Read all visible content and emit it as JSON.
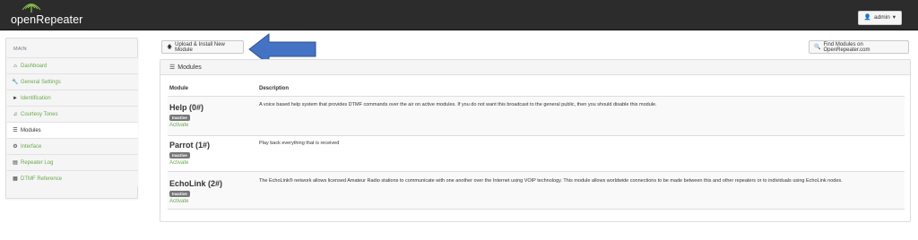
{
  "navbar": {
    "brand_text": "openRepeater",
    "user_label": "admin"
  },
  "sidebar": {
    "heading": "MAIN",
    "items": [
      {
        "label": "Dashboard",
        "icon": "home-icon",
        "active": false
      },
      {
        "label": "General Settings",
        "icon": "wrench-icon",
        "active": false
      },
      {
        "label": "Identification",
        "icon": "bullhorn-icon",
        "active": false
      },
      {
        "label": "Courtesy Tones",
        "icon": "music-icon",
        "active": false
      },
      {
        "label": "Modules",
        "icon": "list-icon",
        "active": true
      },
      {
        "label": "Interface",
        "icon": "cog-icon",
        "active": false
      },
      {
        "label": "Repeater Log",
        "icon": "log-icon",
        "active": false
      },
      {
        "label": "DTMF Reference",
        "icon": "keypad-icon",
        "active": false
      }
    ]
  },
  "toolbar": {
    "upload_label": "Upload & Install New Module",
    "find_label": "Find Modules on OpenRepeater.com"
  },
  "panel": {
    "title": "Modules",
    "columns": [
      "Module",
      "Description"
    ],
    "modules": [
      {
        "name": "Help (0#)",
        "status": "Inactive",
        "action": "Activate",
        "description": "A voice based help system that provides DTMF commands over the air on active modules. If you do not want this broadcast to the general public, then you should disable this module."
      },
      {
        "name": "Parrot (1#)",
        "status": "Inactive",
        "action": "Activate",
        "description": "Play back everything that is received"
      },
      {
        "name": "EchoLink (2#)",
        "status": "Inactive",
        "action": "Activate",
        "description": "The EchoLink® network allows licensed Amateur Radio stations to communicate with one another over the Internet using VOIP technology. This module allows worldwide connections to be made between this and other repeaters or to individuals using EchoLink nodes."
      }
    ]
  },
  "colors": {
    "navbar_bg": "#2c2c2c",
    "link_green": "#6aa84f",
    "badge_gray": "#777777",
    "arrow_blue": "#4472c4"
  }
}
